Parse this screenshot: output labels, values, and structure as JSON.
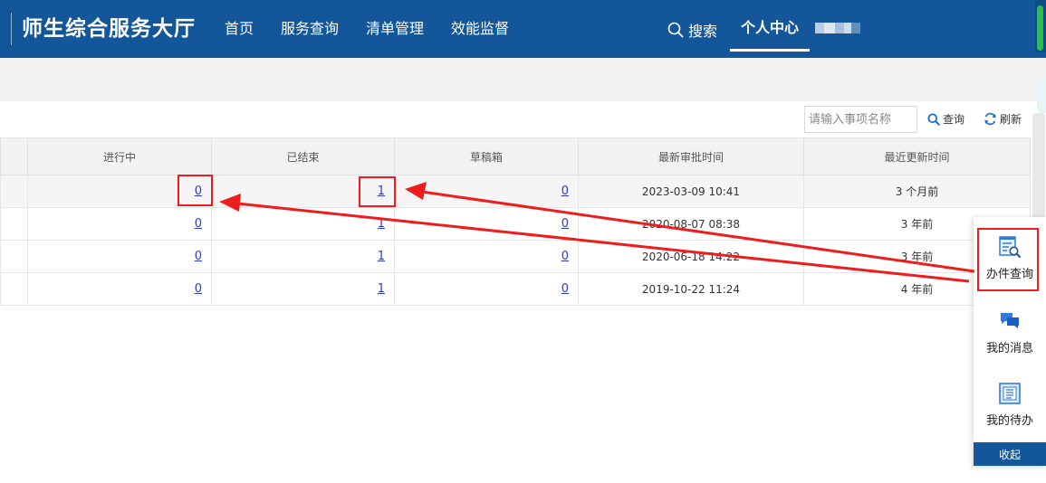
{
  "header": {
    "brand": "师生综合服务大厅",
    "nav": [
      "首页",
      "服务查询",
      "清单管理",
      "效能监督"
    ],
    "search_label": "搜索",
    "personal_center": "个人中心"
  },
  "toolbar": {
    "search_placeholder": "请输入事项名称",
    "query_label": "查询",
    "refresh_label": "刷新"
  },
  "table": {
    "columns": [
      "进行中",
      "已结束",
      "草稿箱",
      "最新审批时间",
      "最近更新时间"
    ],
    "rows": [
      {
        "in_progress": "0",
        "finished": "1",
        "drafts": "0",
        "latest_approval": "2023-03-09 10:41",
        "last_update": "3 个月前"
      },
      {
        "in_progress": "0",
        "finished": "1",
        "drafts": "0",
        "latest_approval": "2020-08-07 08:38",
        "last_update": "3 年前"
      },
      {
        "in_progress": "0",
        "finished": "1",
        "drafts": "0",
        "latest_approval": "2020-06-18 14:22",
        "last_update": "3 年前"
      },
      {
        "in_progress": "0",
        "finished": "1",
        "drafts": "0",
        "latest_approval": "2019-10-22 11:24",
        "last_update": "4 年前"
      }
    ]
  },
  "side_panel": {
    "items": [
      {
        "label": "办件查询",
        "icon": "document-search-icon"
      },
      {
        "label": "我的消息",
        "icon": "chat-bubble-icon"
      },
      {
        "label": "我的待办",
        "icon": "todo-list-icon"
      }
    ],
    "collapse_label": "收起"
  },
  "colors": {
    "header_bg": "#13579a",
    "link": "#2a3ec8",
    "annotation": "#ee1c1c"
  }
}
